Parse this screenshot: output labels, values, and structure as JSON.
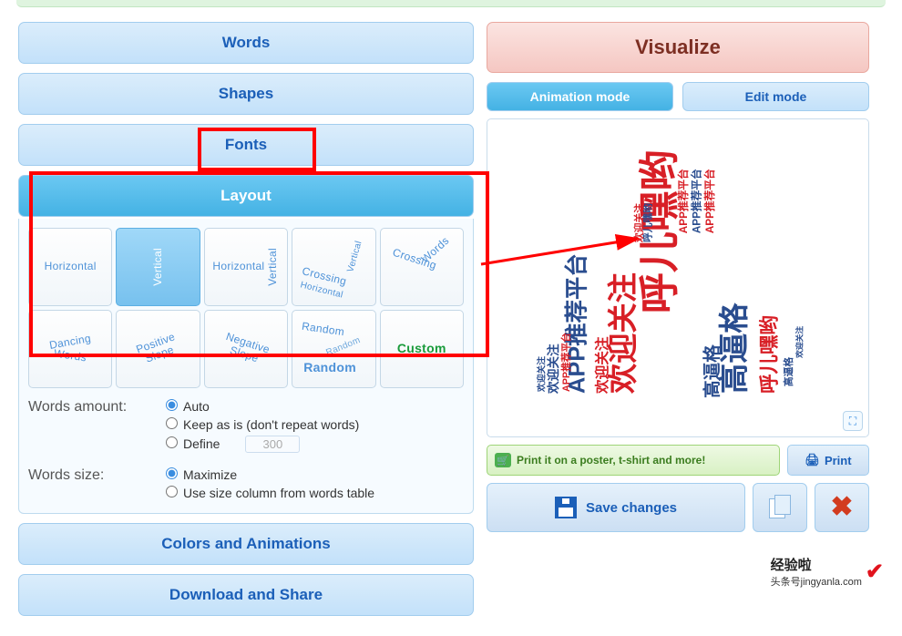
{
  "left_tabs": {
    "words": "Words",
    "shapes": "Shapes",
    "fonts": "Fonts",
    "layout": "Layout",
    "colors": "Colors and Animations",
    "download": "Download and Share"
  },
  "layout_options": [
    {
      "name": "horizontal",
      "label": "Horizontal"
    },
    {
      "name": "vertical",
      "label": "Vertical"
    },
    {
      "name": "horiz-vert",
      "label_h": "Horizontal",
      "label_v": "Vertical"
    },
    {
      "name": "crossing-hv",
      "label_a": "Crossing",
      "label_b": "Vertical",
      "label_c": "Horizontal"
    },
    {
      "name": "crossing-words",
      "label_a": "Crossing",
      "label_b": "Words"
    },
    {
      "name": "dancing",
      "label_a": "Dancing",
      "label_b": "Words"
    },
    {
      "name": "positive-slope",
      "label_a": "Positive",
      "label_b": "Slope"
    },
    {
      "name": "negative-slope",
      "label_a": "Negative",
      "label_b": "Slope"
    },
    {
      "name": "random",
      "label_a": "Random",
      "label_b": "Random",
      "label_c": "Random"
    },
    {
      "name": "custom",
      "label": "Custom"
    }
  ],
  "words_amount": {
    "label": "Words amount:",
    "options": {
      "auto": "Auto",
      "keep": "Keep as is (don't repeat words)",
      "define": "Define"
    },
    "define_value": "300"
  },
  "words_size": {
    "label": "Words size:",
    "options": {
      "max": "Maximize",
      "col": "Use size column from words table"
    }
  },
  "right": {
    "title": "Visualize",
    "animation_mode": "Animation mode",
    "edit_mode": "Edit mode",
    "poster": "Print it on a poster, t-shirt and more!",
    "print": "Print",
    "save": "Save changes"
  },
  "cloud_words": {
    "a": "呼儿嘿哟",
    "b": "欢迎关注",
    "c": "APP推荐平台",
    "d": "高逼格"
  },
  "watermark": {
    "line1": "经验啦",
    "line2": "头条号jingyanla.com"
  }
}
